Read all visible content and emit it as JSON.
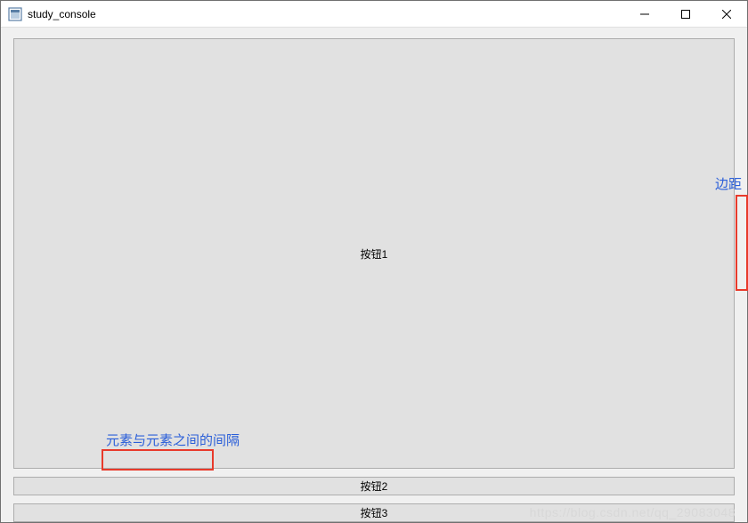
{
  "window": {
    "title": "study_console"
  },
  "buttons": {
    "btn1": "按钮1",
    "btn2": "按钮2",
    "btn3": "按钮3"
  },
  "annotations": {
    "margin_label": "边距",
    "spacing_label": "元素与元素之间的间隔"
  },
  "watermark": "https://blog.csdn.net/qq_29083048"
}
